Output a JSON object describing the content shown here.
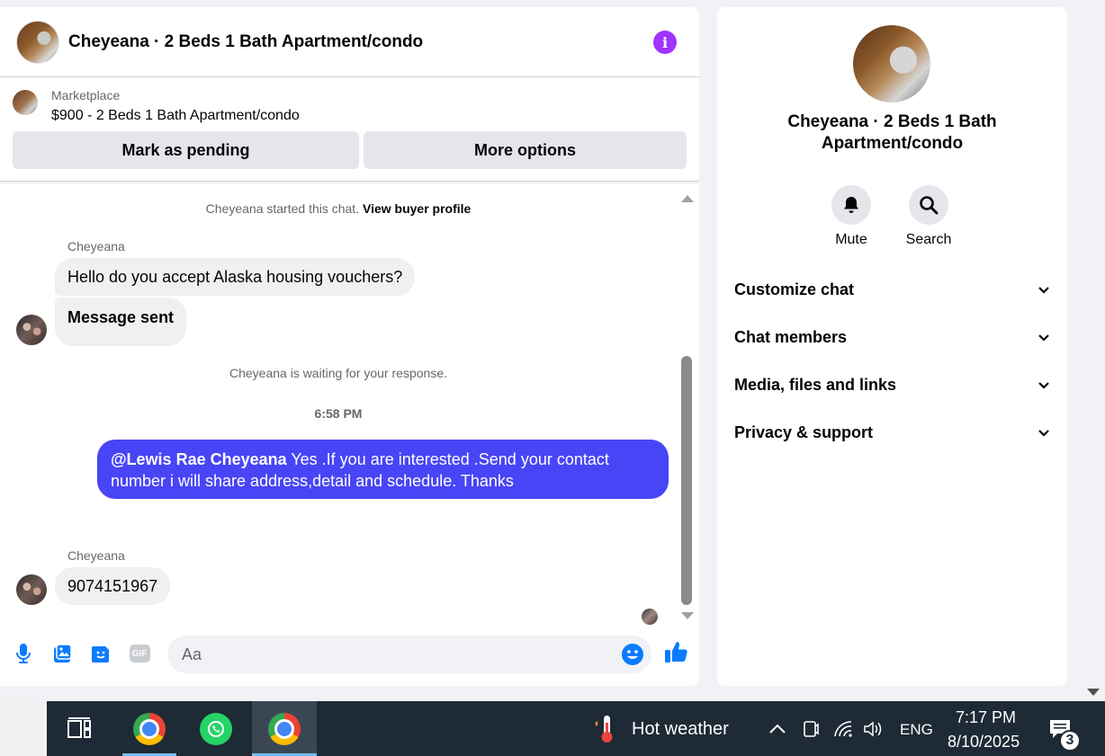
{
  "chat": {
    "title": "Cheyeana · 2 Beds 1 Bath Apartment/condo",
    "listing": {
      "source": "Marketplace",
      "title": "$900 - 2 Beds 1 Bath Apartment/condo",
      "pending_label": "Mark as pending",
      "more_label": "More options"
    },
    "started_text": "Cheyeana started this chat.",
    "buyer_profile_link": "View buyer profile",
    "messages": [
      {
        "sender": "Cheyeana",
        "text": "Hello do you accept Alaska housing vouchers?"
      },
      {
        "text": "Message sent"
      }
    ],
    "waiting_text": "Cheyeana is waiting for your response.",
    "time": "6:58 PM",
    "outgoing": {
      "mention": "@Lewis Rae Cheyeana",
      "text": " Yes .If you are interested .Send your contact number i will share address,detail and schedule. Thanks"
    },
    "reply": {
      "sender": "Cheyeana",
      "text": "9074151967"
    },
    "composer_placeholder": "Aa",
    "composer_gif": "GIF"
  },
  "info": {
    "title": "Cheyeana · 2 Beds 1 Bath Apartment/condo",
    "mute_label": "Mute",
    "search_label": "Search",
    "sections": [
      "Customize chat",
      "Chat members",
      "Media, files and links",
      "Privacy & support"
    ]
  },
  "taskbar": {
    "weather": "Hot weather",
    "lang": "ENG",
    "time": "7:17 PM",
    "date": "8/10/2025",
    "notifications": "3"
  },
  "colors": {
    "accent": "#a033ff",
    "outgoing_bubble": "#4845f6",
    "composer_icons": "#0a7cff"
  }
}
